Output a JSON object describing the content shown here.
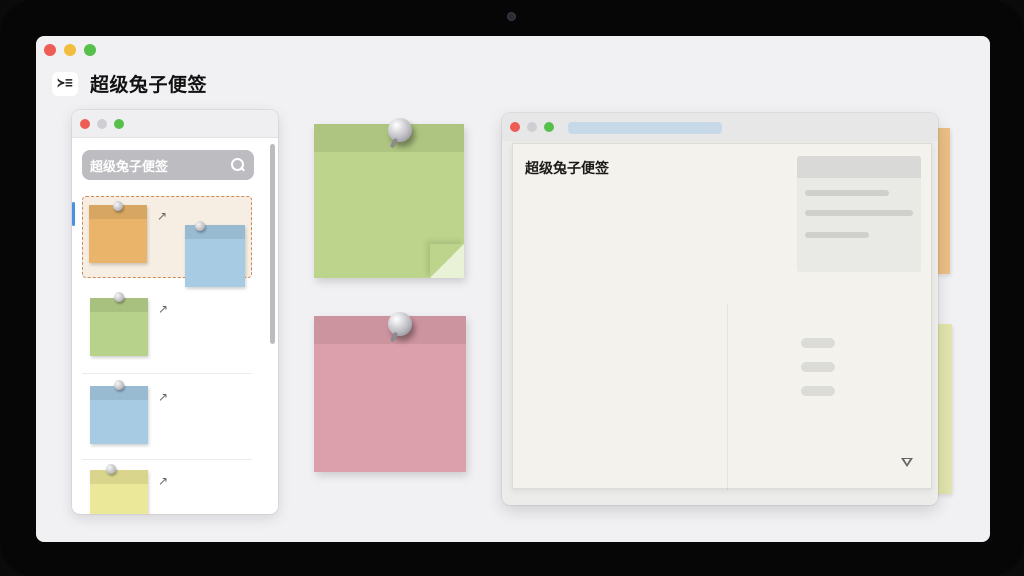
{
  "app": {
    "title": "超级兔子便签",
    "toggle_glyph": "≻≡"
  },
  "sidebar": {
    "search": {
      "placeholder": "超级兔子便签"
    },
    "notes": [
      {
        "color": "#eab56b",
        "selected": true
      },
      {
        "color": "#b7d28a",
        "selected": false
      },
      {
        "color": "#a7cbe3",
        "selected": false
      },
      {
        "color": "#ece89a",
        "selected": false
      }
    ],
    "arrow_glyph": "↗"
  },
  "board": {
    "notes": [
      {
        "color": "#bcd48b",
        "name": "green-note"
      },
      {
        "color": "#dca0ac",
        "name": "pink-note"
      }
    ]
  },
  "detail": {
    "title": "超级兔子便签"
  },
  "colors": {
    "accent": "#4a90e2",
    "selected_border": "#d08a5a",
    "orange": "#eab56b",
    "blue": "#a7cbe3",
    "green": "#bcd48b",
    "pink": "#dca0ac",
    "yellow": "#ece89a"
  }
}
